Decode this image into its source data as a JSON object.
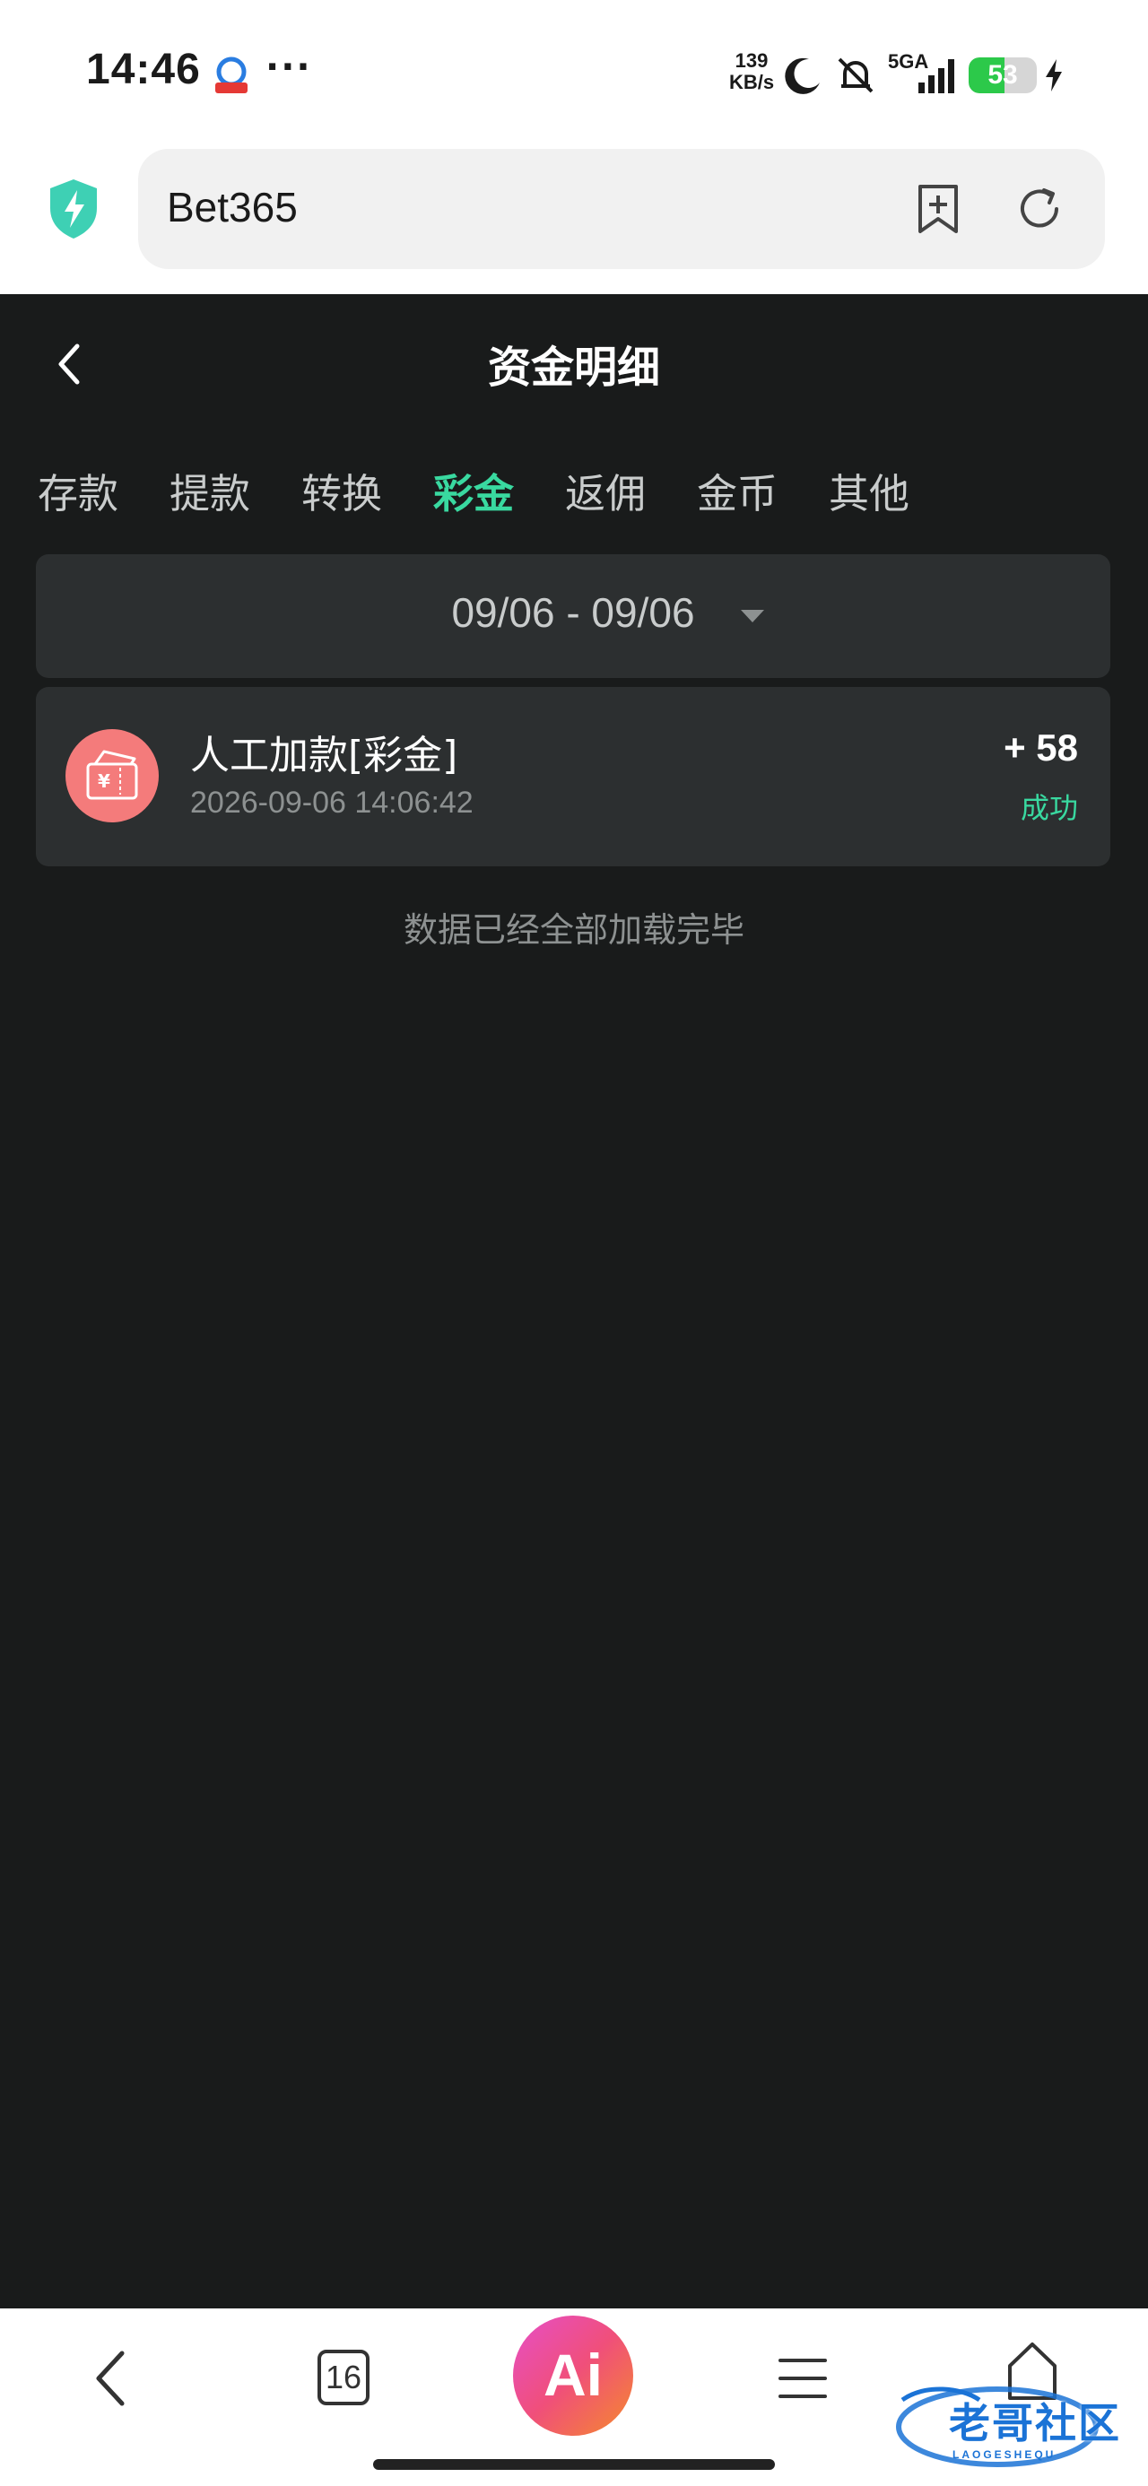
{
  "status_bar": {
    "time": "14:46",
    "more": "···",
    "net_speed_value": "139",
    "net_speed_unit": "KB/s",
    "network": "5GA",
    "battery": "53",
    "battery_level": 0.53
  },
  "browser": {
    "url": "Bet365"
  },
  "page": {
    "title": "资金明细"
  },
  "tabs": [
    {
      "label": "存款",
      "active": false
    },
    {
      "label": "提款",
      "active": false
    },
    {
      "label": "转换",
      "active": false
    },
    {
      "label": "彩金",
      "active": true
    },
    {
      "label": "返佣",
      "active": false
    },
    {
      "label": "金币",
      "active": false
    },
    {
      "label": "其他",
      "active": false
    }
  ],
  "date_filter": {
    "range": "09/06 - 09/06"
  },
  "transactions": [
    {
      "title": "人工加款[彩金]",
      "time": "2026-09-06 14:06:42",
      "amount": "+ 58",
      "status": "成功"
    }
  ],
  "load_end_text": "数据已经全部加载完毕",
  "bottom_nav": {
    "tabs_count": "16",
    "ai_label": "Ai"
  },
  "watermark": {
    "text": "老哥社区",
    "sub": "LAOGESHEQU"
  },
  "colors": {
    "background": "#191b1b",
    "card": "#2c2f30",
    "accent": "#39d9a0",
    "muted": "#8d9191"
  }
}
